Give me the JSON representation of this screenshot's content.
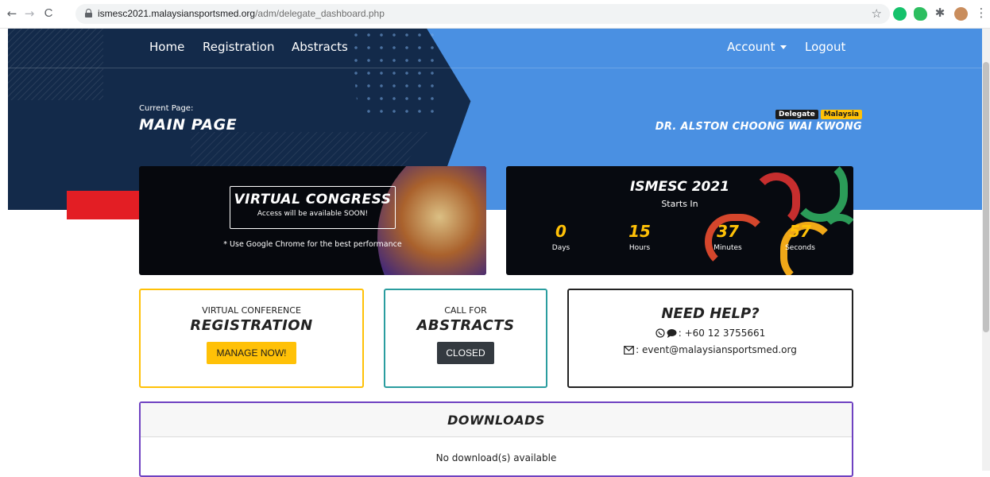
{
  "browser": {
    "back": "←",
    "forward": "→",
    "reload": "C",
    "url_host": "ismesc2021.malaysiansportsmed.org",
    "url_path": "/adm/delegate_dashboard.php"
  },
  "nav": {
    "home": "Home",
    "registration": "Registration",
    "abstracts": "Abstracts",
    "account": "Account",
    "logout": "Logout"
  },
  "header": {
    "current_label": "Current Page:",
    "page_title": "MAIN PAGE",
    "badge_role": "Delegate",
    "badge_country": "Malaysia",
    "user_name": "DR. ALSTON CHOONG WAI KWONG"
  },
  "virtual_congress": {
    "title": "VIRTUAL CONGRESS",
    "subtitle": "Access will be available SOON!",
    "note": "* Use Google Chrome for the best performance"
  },
  "countdown": {
    "title": "ISMESC 2021",
    "subtitle": "Starts In",
    "units": [
      {
        "value": "0",
        "label": "Days"
      },
      {
        "value": "15",
        "label": "Hours"
      },
      {
        "value": "37",
        "label": "Minutes"
      },
      {
        "value": "57",
        "label": "Seconds"
      }
    ]
  },
  "registration_card": {
    "small": "VIRTUAL CONFERENCE",
    "big": "REGISTRATION",
    "button": "MANAGE NOW!"
  },
  "abstracts_card": {
    "small": "CALL FOR",
    "big": "ABSTRACTS",
    "button": "CLOSED"
  },
  "help_card": {
    "title": "NEED HELP?",
    "phone": ": +60 12 3755661",
    "email": ": event@malaysiansportsmed.org"
  },
  "downloads": {
    "title": "DOWNLOADS",
    "empty": "No download(s) available"
  },
  "colors": {
    "hero_dark": "#132a4a",
    "hero_blue": "#4a90e2",
    "accent_yellow": "#ffc107",
    "teal": "#2a9d9f",
    "purple": "#6f42c1",
    "arrow_red": "#e31e24"
  }
}
